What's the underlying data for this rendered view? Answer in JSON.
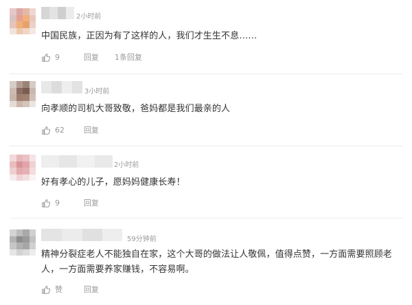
{
  "comments": [
    {
      "time": "2小时前",
      "content": "中国民族，正因为有了这样的人，我们才生生不息……",
      "likes": "9",
      "reply_label": "回复",
      "replies_count_label": "1条回复",
      "avatar_colors": [
        "#e7c7c9",
        "#d9a8a4",
        "#e4b8a8",
        "#efd7cf",
        "#d8c3c0",
        "#e7a08f",
        "#f1b07e",
        "#e8c8bc",
        "#e7c3b8",
        "#f0b07a",
        "#e6a26d",
        "#e9d2ca",
        "#f1e3dd",
        "#eec8ac",
        "#f1d6c6",
        "#f4e8e2"
      ]
    },
    {
      "time": "3小时前",
      "content": "向孝顺的司机大哥致敬，爸妈都是我们最亲的人",
      "likes": "62",
      "reply_label": "回复",
      "avatar_colors": [
        "#d7cdc8",
        "#b39c92",
        "#9c8478",
        "#d6cbc5",
        "#cdbbb1",
        "#8b6f66",
        "#7d5c52",
        "#c8b8ae",
        "#c7b5aa",
        "#9f7d6e",
        "#a08273",
        "#cfc1b9",
        "#e3dbd6",
        "#cbb7ac",
        "#d4c4ba",
        "#ebe5e1"
      ]
    },
    {
      "time": "2小时前",
      "content": "好有孝心的儿子，愿妈妈健康长寿！",
      "likes": "9",
      "reply_label": "回复",
      "avatar_colors": [
        "#f2d9db",
        "#e7b9bd",
        "#ebc2c6",
        "#f4e4e5",
        "#e9bcbd",
        "#d8939a",
        "#e2a4ab",
        "#efd2d3",
        "#efcfd0",
        "#e3aab0",
        "#e6b1b5",
        "#f2dcdd",
        "#f7eced",
        "#f0d3d5",
        "#f3dfe0",
        "#faf3f3"
      ]
    },
    {
      "time": "59分钟前",
      "content": "精神分裂症老人不能独自在家，这个大哥的做法让人敬佩，值得点赞，一方面需要照顾老人，一方面需要养家赚钱，不容易啊。",
      "likes_label": "赞",
      "reply_label": "回复",
      "avatar_colors": [
        "#d4d4d4",
        "#bdbdbd",
        "#a9a9a9",
        "#cfcfcf",
        "#b3b3b3",
        "#8d8d8d",
        "#9a9a9a",
        "#c1c1c1",
        "#c6c6c6",
        "#b0b0b0",
        "#a6a6a6",
        "#d0d0d0",
        "#e6e6e6",
        "#d2d2d2",
        "#dcdcdc",
        "#ededed"
      ]
    }
  ],
  "colors": {
    "text": "#333333",
    "meta": "#999999",
    "divider": "#ececec"
  },
  "icons": [
    "thumbs-up-icon"
  ]
}
